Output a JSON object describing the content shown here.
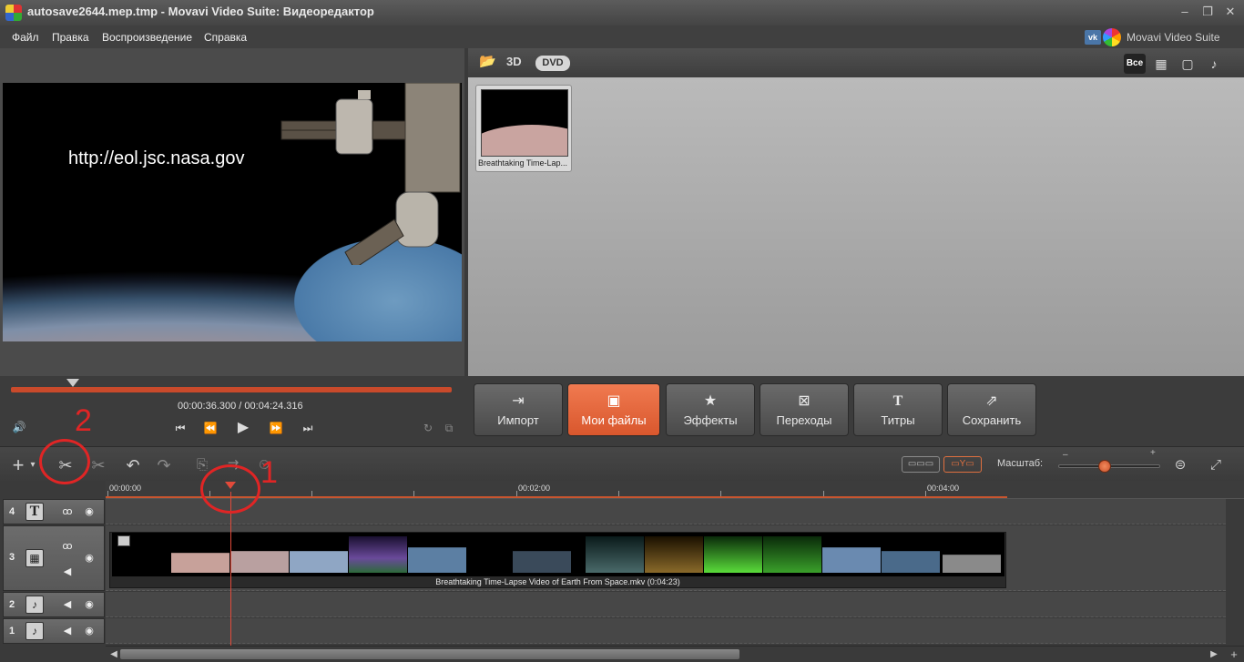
{
  "window": {
    "title": "autosave2644.mep.tmp - Movavi Video Suite: Видеоредактор",
    "controls": [
      "–",
      "❐",
      "✕"
    ]
  },
  "menu": [
    "Файл",
    "Правка",
    "Воспроизведение",
    "Справка"
  ],
  "brand": {
    "vk": "vk",
    "name": "Movavi Video Suite"
  },
  "preview": {
    "overlay_text": "http://eol.jsc.nasa.gov"
  },
  "library": {
    "tools": {
      "folder": "📂",
      "three_d": "3D",
      "dvd": "DVD"
    },
    "filters": {
      "all": "Все",
      "video": "▦",
      "image": "▢",
      "audio": "♪"
    },
    "files": [
      {
        "label": "Breathtaking Time-Lap..."
      }
    ]
  },
  "transport": {
    "current_time": "00:00:36.300",
    "separator": "/",
    "total_time": "00:04:24.316",
    "playback_fraction": 0.14,
    "buttons": {
      "volume": "🔊",
      "start": "⏮",
      "rewind": "⏪",
      "play": "▶",
      "forward": "⏩",
      "end": "⏭",
      "loop": "↻",
      "crop": "⧉"
    }
  },
  "modes": [
    {
      "icon": "⇥",
      "label": "Импорт"
    },
    {
      "icon": "▣",
      "label": "Мои файлы"
    },
    {
      "icon": "★",
      "label": "Эффекты"
    },
    {
      "icon": "⊠",
      "label": "Переходы"
    },
    {
      "icon": "T",
      "label": "Титры"
    },
    {
      "icon": "⇗",
      "label": "Сохранить"
    }
  ],
  "timeline_toolbar": {
    "add": "+",
    "add_arrow": "▾",
    "split": "✂",
    "cut": "✂",
    "undo": "↶",
    "redo": "↷",
    "t1": "⎘",
    "t2": "⇉",
    "t3": "⏲",
    "storyboard": "▭▭▭",
    "timeline": "▭Y▭",
    "zoom_label": "Масштаб:",
    "zoom_minus": "–",
    "zoom_plus": "+",
    "zoom_level": 0.45,
    "zoom_fit": "⊜",
    "fullscreen": "⤢"
  },
  "ruler": {
    "labels": [
      "00:00:00",
      "00:02:00",
      "00:04:00"
    ]
  },
  "tracks": [
    {
      "num": "4",
      "type_icon": "T",
      "fx_icon": "ꝏ",
      "eye_icon": "◉"
    },
    {
      "num": "3",
      "type_icon": "▦",
      "fx_icon": "ꝏ",
      "audio_icon": "◀",
      "eye_icon": "◉"
    },
    {
      "num": "2",
      "type_icon": "♪",
      "audio_icon": "◀",
      "eye_icon": "◉"
    },
    {
      "num": "1",
      "type_icon": "♪",
      "audio_icon": "◀",
      "eye_icon": "◉"
    }
  ],
  "clip": {
    "label": "Breathtaking Time-Lapse Video of Earth From Space.mkv (0:04:23)"
  },
  "scrollbar": {
    "left": "◀",
    "right": "▶",
    "plus": "+"
  },
  "annotations": {
    "n1": "1",
    "n2": "2"
  },
  "colors": {
    "accent": "#e0703f",
    "annotation": "#e02525",
    "playhead": "#e24a3a"
  }
}
